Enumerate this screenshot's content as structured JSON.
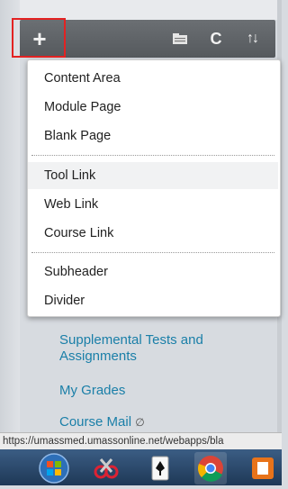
{
  "toolbar": {
    "add_icon": "+",
    "folder_icon": "folder-icon",
    "refresh_icon": "C",
    "sort_icon": "↑↓"
  },
  "menu": {
    "items": [
      {
        "label": "Content Area"
      },
      {
        "label": "Module Page"
      },
      {
        "label": "Blank Page"
      },
      {
        "label": "Tool Link"
      },
      {
        "label": "Web Link"
      },
      {
        "label": "Course Link"
      },
      {
        "label": "Subheader"
      },
      {
        "label": "Divider"
      }
    ],
    "highlight_color": "#e32222"
  },
  "course_menu": {
    "links": [
      {
        "label": "Supplemental Tests and Assignments"
      },
      {
        "label": "My Grades"
      },
      {
        "label": "Course Mail"
      }
    ],
    "link_color": "#1a7fa8"
  },
  "status_bar": {
    "url": "https://umassmed.umassonline.net/webapps/bla"
  },
  "taskbar": {
    "icons": [
      "windows-start-icon",
      "snipping-tool-icon",
      "solitaire-icon",
      "chrome-icon",
      "orange-app-icon"
    ]
  }
}
